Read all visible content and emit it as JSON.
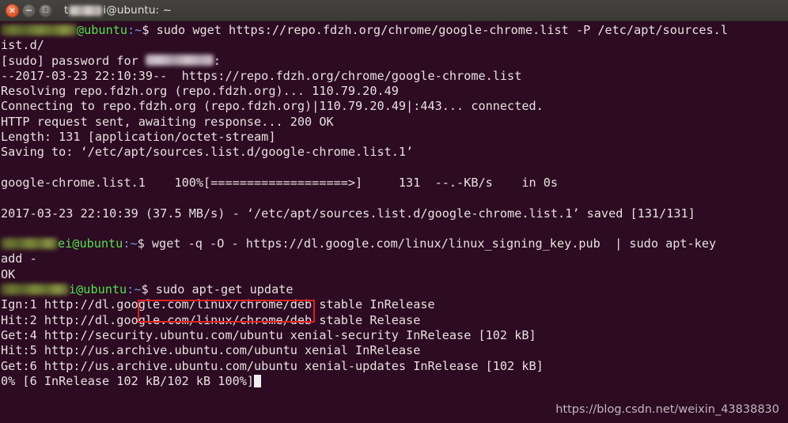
{
  "window": {
    "title": "t████i@ubuntu: ~",
    "title_prefix": "t",
    "title_suffix": "i@ubuntu: ~",
    "controls": {
      "close": "×",
      "minimize": "−",
      "maximize": "□"
    },
    "background_color": "#2d0b22",
    "titlebar_color": "#3b3936",
    "close_button_color": "#e2552a"
  },
  "terminal": {
    "prompt": {
      "host": "@ubuntu",
      "path": ":~",
      "sigil": "$",
      "user_color": "#4ee44e",
      "path_color": "#6a9ff5"
    },
    "lines": [
      {
        "type": "prompt",
        "user_blur": "u1",
        "command": " sudo wget https://repo.fdzh.org/chrome/google-chrome.list -P /etc/apt/sources.l"
      },
      {
        "type": "text",
        "text": "ist.d/"
      },
      {
        "type": "password",
        "prefix": "[sudo] password for ",
        "suffix": ":"
      },
      {
        "type": "text",
        "text": "--2017-03-23 22:10:39--  https://repo.fdzh.org/chrome/google-chrome.list"
      },
      {
        "type": "text",
        "text": "Resolving repo.fdzh.org (repo.fdzh.org)... 110.79.20.49"
      },
      {
        "type": "text",
        "text": "Connecting to repo.fdzh.org (repo.fdzh.org)|110.79.20.49|:443... connected."
      },
      {
        "type": "text",
        "text": "HTTP request sent, awaiting response... 200 OK"
      },
      {
        "type": "text",
        "text": "Length: 131 [application/octet-stream]"
      },
      {
        "type": "text",
        "text": "Saving to: ‘/etc/apt/sources.list.d/google-chrome.list.1’"
      },
      {
        "type": "text",
        "text": ""
      },
      {
        "type": "text",
        "text": "google-chrome.list.1    100%[===================>]     131  --.-KB/s    in 0s"
      },
      {
        "type": "text",
        "text": ""
      },
      {
        "type": "text",
        "text": "2017-03-23 22:10:39 (37.5 MB/s) - ‘/etc/apt/sources.list.d/google-chrome.list.1’ saved [131/131]"
      },
      {
        "type": "text",
        "text": ""
      },
      {
        "type": "prompt",
        "user_blur": "u2",
        "user_tail": "ei",
        "command": " wget -q -O - https://dl.google.com/linux/linux_signing_key.pub  | sudo apt-key"
      },
      {
        "type": "text",
        "text": "add -"
      },
      {
        "type": "text",
        "text": "OK"
      },
      {
        "type": "prompt",
        "user_blur": "u3",
        "user_tail": "i",
        "command": " sudo apt-get update",
        "highlighted": true
      },
      {
        "type": "text",
        "text": "Ign:1 http://dl.google.com/linux/chrome/deb stable InRelease"
      },
      {
        "type": "text",
        "text": "Hit:2 http://dl.google.com/linux/chrome/deb stable Release"
      },
      {
        "type": "text",
        "text": "Get:4 http://security.ubuntu.com/ubuntu xenial-security InRelease [102 kB]"
      },
      {
        "type": "text",
        "text": "Hit:5 http://us.archive.ubuntu.com/ubuntu xenial InRelease"
      },
      {
        "type": "text",
        "text": "Get:6 http://us.archive.ubuntu.com/ubuntu xenial-updates InRelease [102 kB]"
      },
      {
        "type": "cursor",
        "text": "0% [6 InRelease 102 kB/102 kB 100%]"
      }
    ],
    "highlight_box_color": "#e02020"
  },
  "watermark": {
    "text": "https://blog.csdn.net/weixin_43838830"
  }
}
